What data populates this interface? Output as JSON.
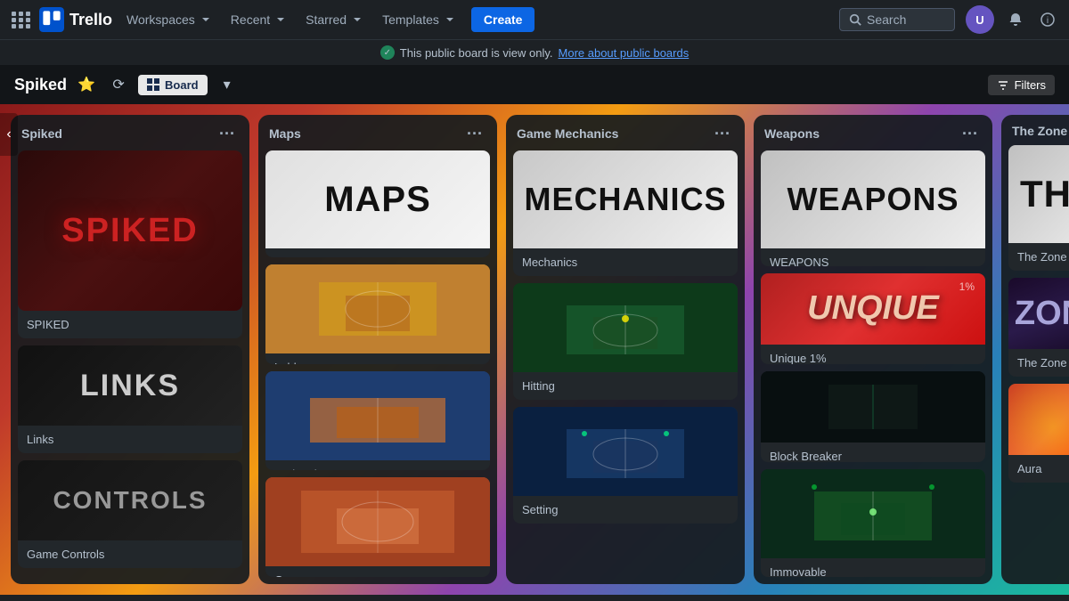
{
  "nav": {
    "logo_text": "Trello",
    "workspaces_label": "Workspaces",
    "recent_label": "Recent",
    "starred_label": "Starred",
    "templates_label": "Templates",
    "create_label": "Create",
    "search_placeholder": "Search"
  },
  "notif": {
    "message": "This public board is view only.",
    "link_text": "More about public boards"
  },
  "board_header": {
    "title": "Spiked",
    "view_icon": "⊞",
    "view_label": "Board",
    "filters_label": "Filters"
  },
  "columns": [
    {
      "id": "spiked",
      "title": "Spiked",
      "cards": [
        {
          "id": "spiked-hero",
          "type": "hero",
          "label": "SPIKED"
        },
        {
          "id": "links",
          "type": "text-card",
          "img_text": "LINKS",
          "label": "Links"
        },
        {
          "id": "controls",
          "type": "text-card",
          "img_text": "CONTROLS",
          "label": "Game Controls"
        }
      ]
    },
    {
      "id": "maps",
      "title": "Maps",
      "cards": [
        {
          "id": "maps-cover",
          "type": "cover",
          "img_text": "MAPS",
          "label": "Maps"
        },
        {
          "id": "lobby",
          "type": "arena",
          "label": "Lobby"
        },
        {
          "id": "nationals",
          "type": "arena",
          "label": "Nationals"
        },
        {
          "id": "gym",
          "type": "arena",
          "label": "Gym"
        }
      ]
    },
    {
      "id": "mechanics",
      "title": "Game Mechanics",
      "cards": [
        {
          "id": "mechanics-cover",
          "type": "cover",
          "img_text": "MECHANICS",
          "label": "Mechanics"
        },
        {
          "id": "hitting",
          "type": "arena",
          "label": "Hitting"
        },
        {
          "id": "setting",
          "type": "arena",
          "label": "Setting"
        }
      ]
    },
    {
      "id": "weapons",
      "title": "Weapons",
      "cards": [
        {
          "id": "weapons-cover",
          "type": "cover",
          "img_text": "WEAPONS",
          "label": "WEAPONS"
        },
        {
          "id": "unique",
          "type": "special",
          "img_text": "UNQIUE",
          "label": "Unique 1%"
        },
        {
          "id": "blockbreaker",
          "type": "dark-arena",
          "label": "Block Breaker"
        },
        {
          "id": "immovable",
          "type": "arena2",
          "label": "Immovable"
        }
      ]
    },
    {
      "id": "thezone",
      "title": "The Zone",
      "partial": true,
      "cards": [
        {
          "id": "thezone-cover",
          "type": "cover-partial",
          "img_text": "TH",
          "label": "The Zone"
        },
        {
          "id": "zone2",
          "type": "text-zone",
          "img_text": "ZON",
          "label": "The Zone"
        },
        {
          "id": "aura",
          "type": "aura-card",
          "label": "Aura"
        }
      ]
    }
  ]
}
